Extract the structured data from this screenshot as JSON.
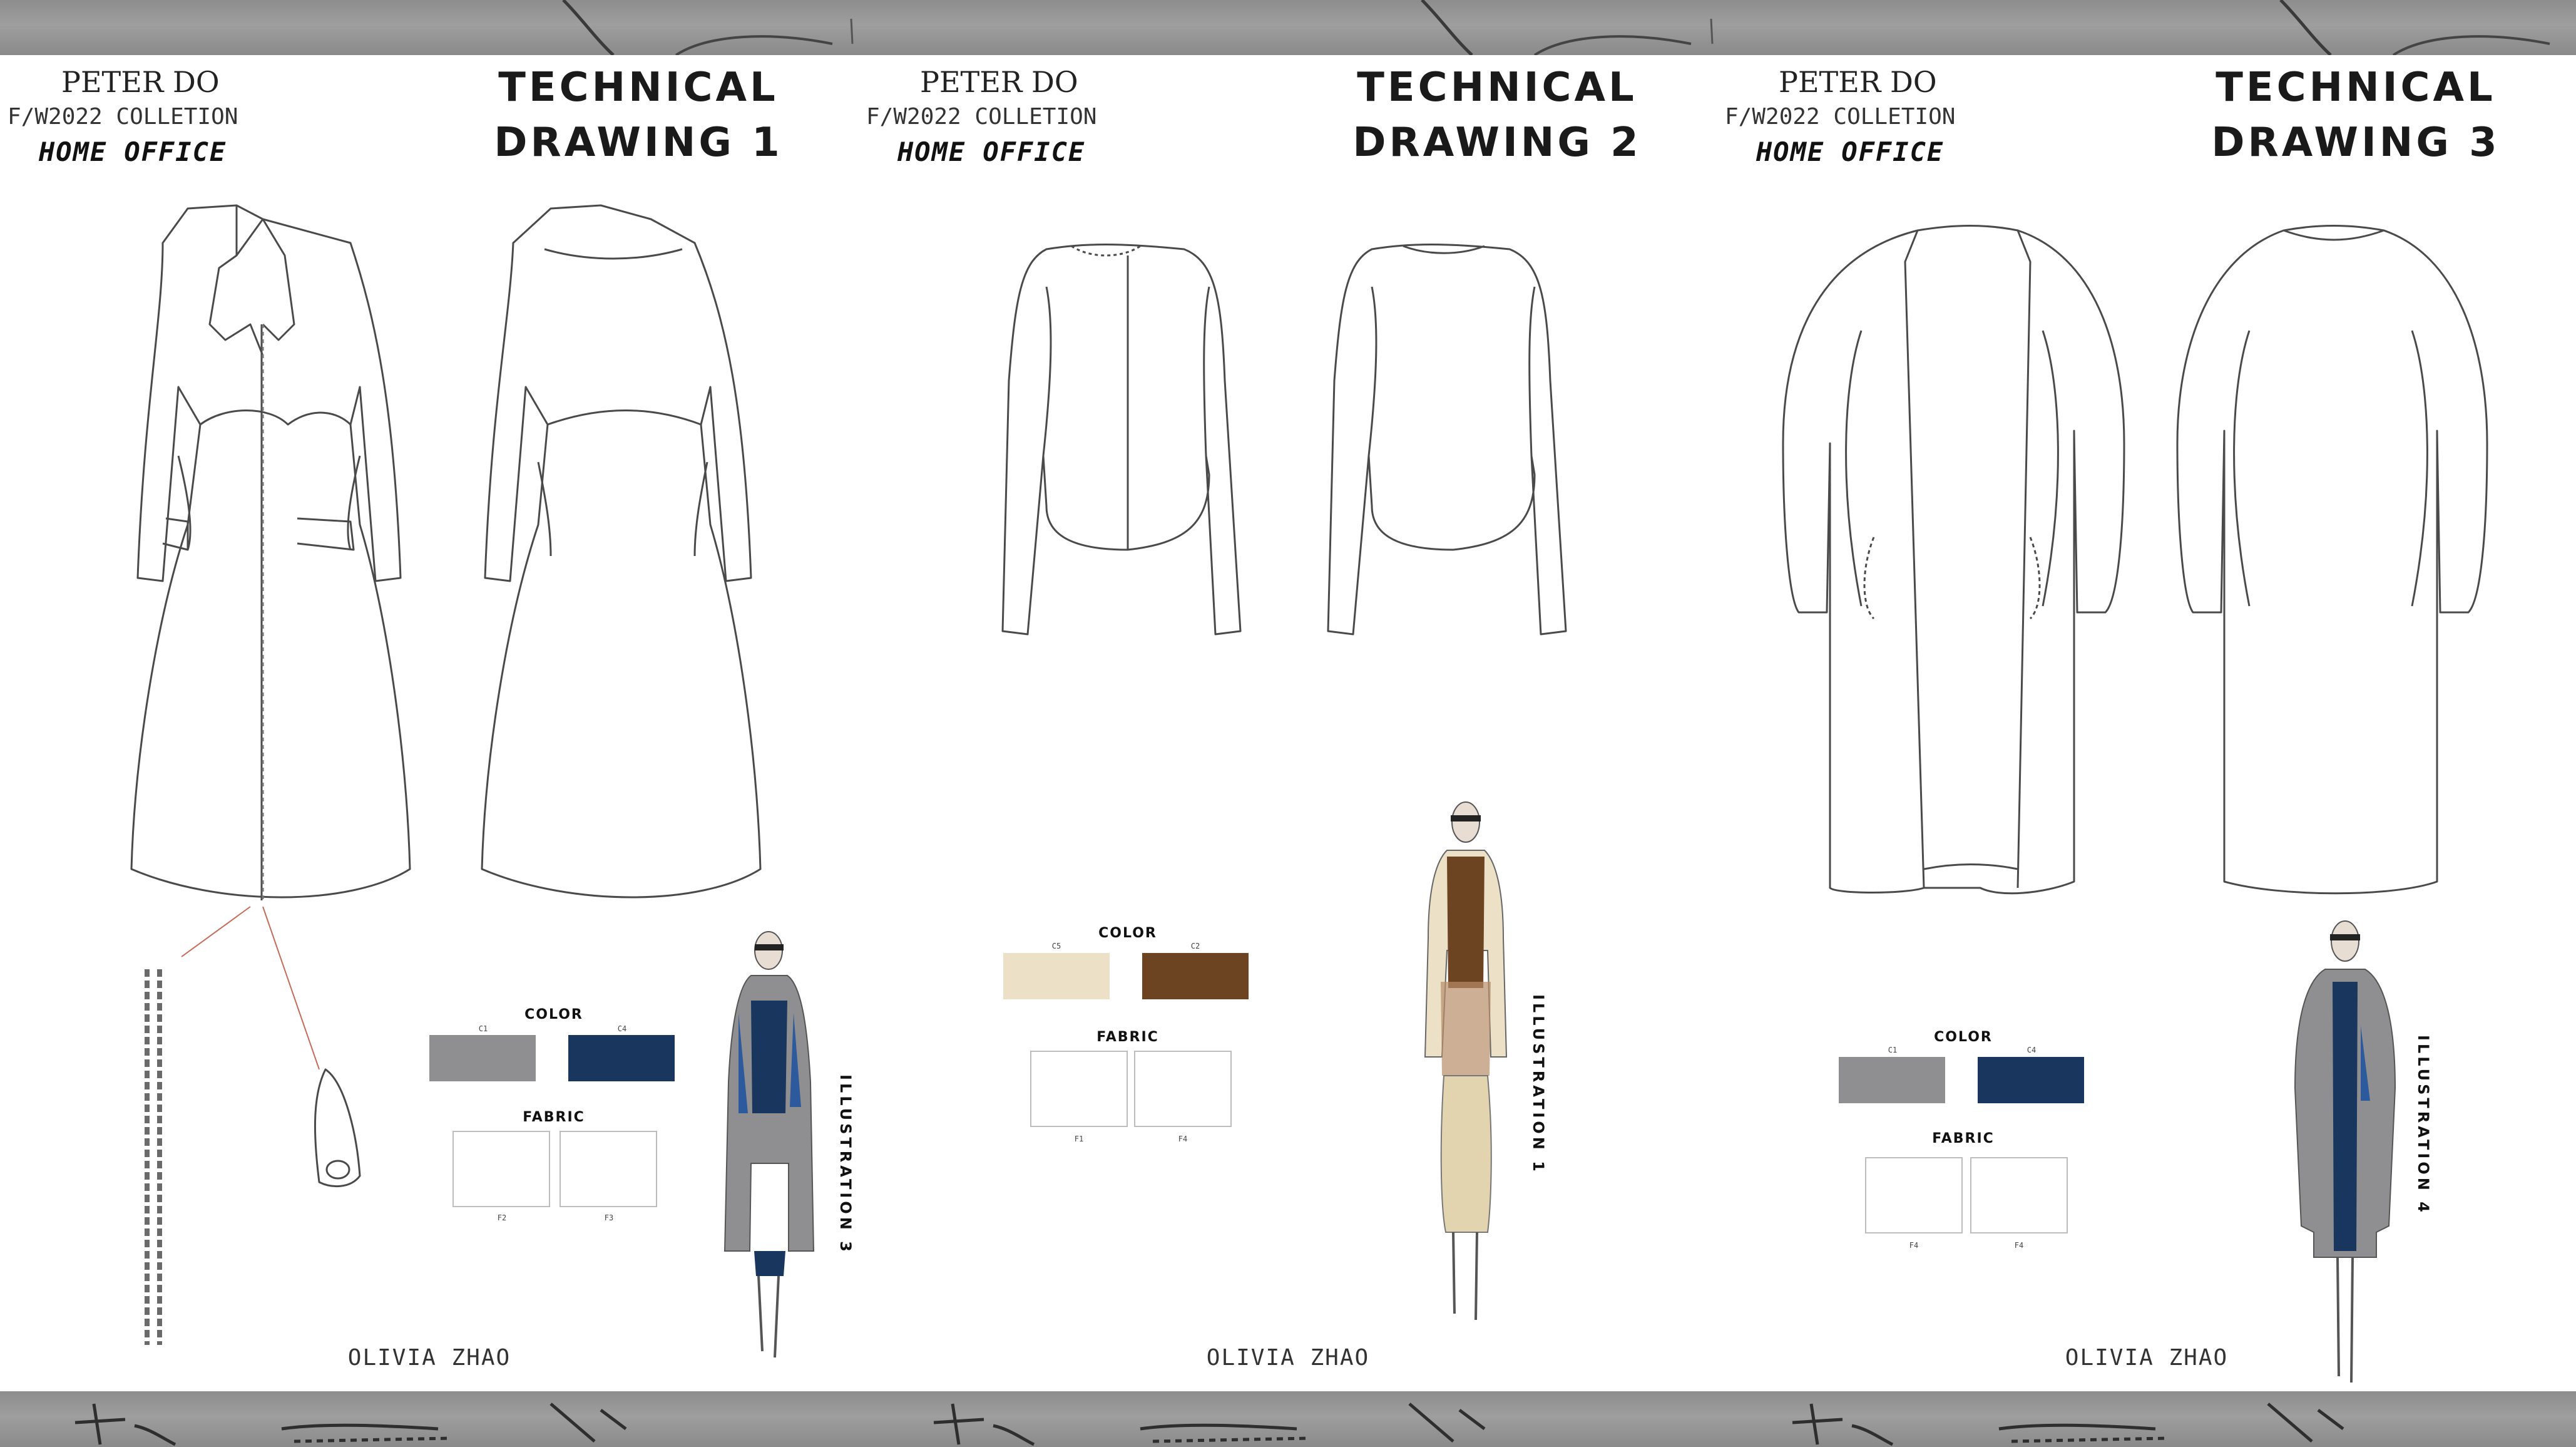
{
  "header": {
    "brand": "PETER DO",
    "collection": "F/W2022 COLLETION",
    "line": "HOME OFFICE"
  },
  "author": "OLIVIA ZHAO",
  "panels": [
    {
      "title_line1": "TECHNICAL",
      "title_line2": "DRAWING 1",
      "illustration": "ILLUSTRATION 3",
      "color_label": "COLOR",
      "fabric_label": "FABRIC",
      "color_codes": [
        "C1",
        "C4"
      ],
      "fabric_codes": [
        "F2",
        "F3"
      ],
      "colors": [
        "#8f8f91",
        "#18365e"
      ]
    },
    {
      "title_line1": "TECHNICAL",
      "title_line2": "DRAWING 2",
      "illustration": "ILLUSTRATION 1",
      "color_label": "COLOR",
      "fabric_label": "FABRIC",
      "color_codes": [
        "C5",
        "C2"
      ],
      "fabric_codes": [
        "F1",
        "F4"
      ],
      "colors": [
        "#ece1c7",
        "#6c4421"
      ]
    },
    {
      "title_line1": "TECHNICAL",
      "title_line2": "DRAWING 3",
      "illustration": "ILLUSTRATION 4",
      "color_label": "COLOR",
      "fabric_label": "FABRIC",
      "color_codes": [
        "C1",
        "C4"
      ],
      "fabric_codes": [
        "F4",
        "F4"
      ],
      "colors": [
        "#8f8f91",
        "#18365e"
      ]
    }
  ]
}
